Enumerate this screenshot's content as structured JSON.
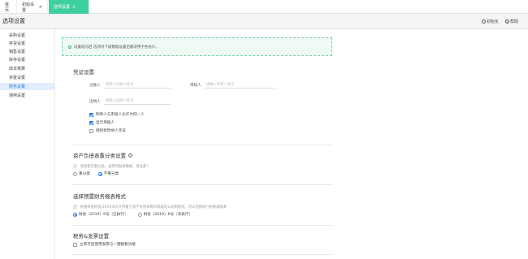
{
  "tabs": {
    "home": "首页",
    "tab2": "初始设置",
    "tab3": "选项设置",
    "close": "×"
  },
  "header": {
    "title": "选项设置",
    "reset": "初始化",
    "help": "帮助"
  },
  "sidebar": {
    "items": [
      {
        "label": "采购设置"
      },
      {
        "label": "存货设置"
      },
      {
        "label": "销售设置"
      },
      {
        "label": "库存设置"
      },
      {
        "label": "成本核算"
      },
      {
        "label": "资金设置"
      },
      {
        "label": "财务设置"
      },
      {
        "label": "通用设置"
      }
    ]
  },
  "notice": {
    "text": "设置成功后 选项对下级数据设置后都适用于各会计。"
  },
  "voucher": {
    "title": "凭证设置",
    "maker_label": "记账人",
    "maker_placeholder": "请输入记账人姓名",
    "auditor_label": "审核人",
    "auditor_placeholder": "请输入审核人姓名",
    "cashier_label": "出纳人",
    "cashier_placeholder": "请输入出纳人姓名",
    "options": [
      {
        "label": "制单人与审核人允许为同一人",
        "checked": true
      },
      {
        "label": "显示单据人",
        "checked": true
      },
      {
        "label": "授权修改他人凭证",
        "checked": false
      }
    ]
  },
  "balance": {
    "title": "资产负债表重分类设置",
    "note": "注：选择是否重分类，会影响报表数据，请注意！",
    "options": [
      {
        "label": "重分类",
        "selected": false
      },
      {
        "label": "不重分类",
        "selected": true
      }
    ]
  },
  "format": {
    "title": "选择预置财务报表格式",
    "note": "注：系统将按财会[2019]6号文预置了资产负债表和利润表的公式和格式，可以选择执行的报表版本",
    "options": [
      {
        "label": "财会〔2019〕6号（已执行）",
        "selected": true
      },
      {
        "label": "财会〔2019〕6号（未执行）",
        "selected": false
      }
    ]
  },
  "tax": {
    "title": "税务&发票设置",
    "options": [
      {
        "label": "立即开启使用发票与一键报税功能",
        "checked": false
      }
    ]
  }
}
